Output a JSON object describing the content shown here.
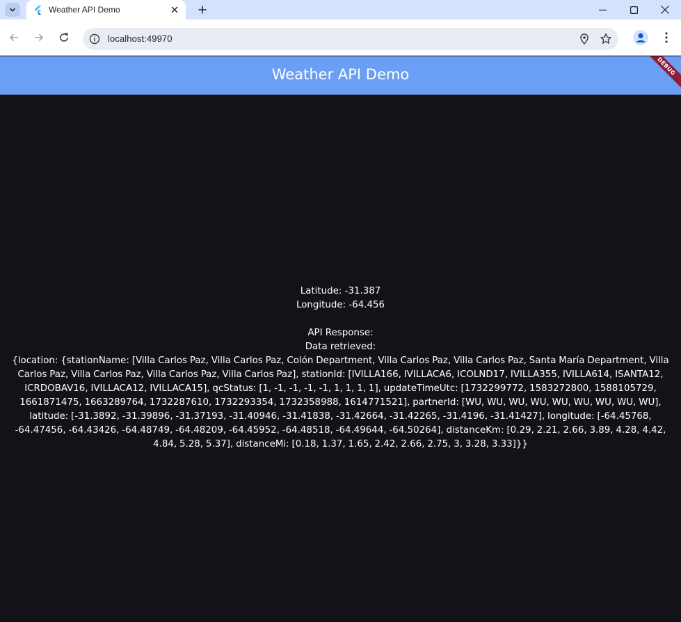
{
  "browser": {
    "tab_title": "Weather API Demo",
    "url": "localhost:49970"
  },
  "app": {
    "title": "Weather API Demo",
    "debug_banner": "DEBUG"
  },
  "content": {
    "latitude": "Latitude: -31.387",
    "longitude": "Longitude: -64.456",
    "api_response_label": "API Response:",
    "data_retrieved": "Data retrieved:",
    "response_text": "{location: {stationName: [Villa Carlos Paz, Villa Carlos Paz, Colón Department, Villa Carlos Paz, Villa Carlos Paz, Santa María Department, Villa Carlos Paz, Villa Carlos Paz, Villa Carlos Paz, Villa Carlos Paz], stationId: [IVILLA166, IVILLACA6, ICOLND17, IVILLA355, IVILLA614, ISANTA12, ICRDOBAV16, IVILLACA12, IVILLACA15], qcStatus: [1, -1, -1, -1, -1, 1, 1, 1, 1], updateTimeUtc: [1732299772, 1583272800, 1588105729, 1661871475, 1663289764, 1732287610, 1732293354, 1732358988, 1614771521], partnerId: [WU, WU, WU, WU, WU, WU, WU, WU, WU], latitude: [-31.3892, -31.39896, -31.37193, -31.40946, -31.41838, -31.42664, -31.42265, -31.4196, -31.41427], longitude: [-64.45768, -64.47456, -64.43426, -64.48749, -64.48209, -64.45952, -64.48518, -64.49644, -64.50264], distanceKm: [0.29, 2.21, 2.66, 3.89, 4.28, 4.42, 4.84, 5.28, 5.37], distanceMi: [0.18, 1.37, 1.65, 2.42, 2.66, 2.75, 3, 3.28, 3.33]}}"
  },
  "colors": {
    "appbar": "#6b9ff5",
    "background": "#141218",
    "debug_banner": "#8b1e3b",
    "tabstrip": "#d3e3fd"
  }
}
